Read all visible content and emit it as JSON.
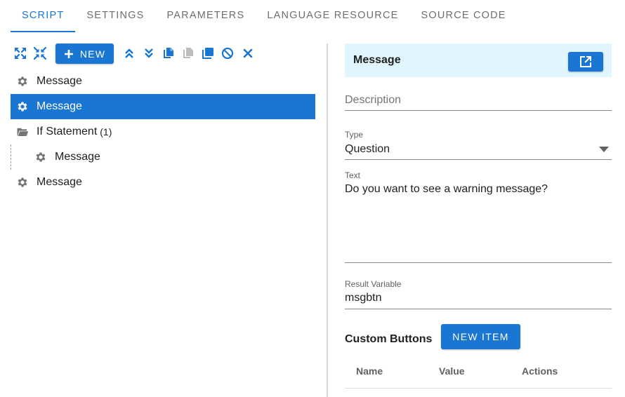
{
  "tabs": [
    {
      "label": "SCRIPT",
      "active": true
    },
    {
      "label": "SETTINGS",
      "active": false
    },
    {
      "label": "PARAMETERS",
      "active": false
    },
    {
      "label": "LANGUAGE RESOURCE",
      "active": false
    },
    {
      "label": "SOURCE CODE",
      "active": false
    }
  ],
  "toolbar": {
    "new_label": "NEW",
    "icons": [
      "expand-all-icon",
      "collapse-all-icon",
      "plus-icon",
      "move-up-icon",
      "move-down-icon",
      "copy-icon",
      "paste-icon",
      "duplicate-icon",
      "disable-icon",
      "delete-icon"
    ]
  },
  "tree": [
    {
      "label": "Message",
      "icon": "gear-icon"
    },
    {
      "label": "Message",
      "icon": "gear-icon",
      "selected": true
    },
    {
      "label": "If Statement",
      "icon": "folder-open-icon",
      "count": "(1)"
    },
    {
      "label": "Message",
      "icon": "gear-icon"
    },
    {
      "label": "Message",
      "icon": "gear-icon"
    }
  ],
  "detail": {
    "title": "Message",
    "description_placeholder": "Description",
    "type_label": "Type",
    "type_value": "Question",
    "text_label": "Text",
    "text_value": "Do you want to see a warning message?",
    "result_label": "Result Variable",
    "result_value": "msgbtn",
    "custom_buttons_title": "Custom Buttons",
    "new_item_label": "NEW ITEM",
    "columns": [
      "Name",
      "Value",
      "Actions"
    ]
  },
  "colors": {
    "accent": "#1976d2",
    "header_bg": "#e1f5fe",
    "tab_inactive": "#6e6e6e"
  }
}
